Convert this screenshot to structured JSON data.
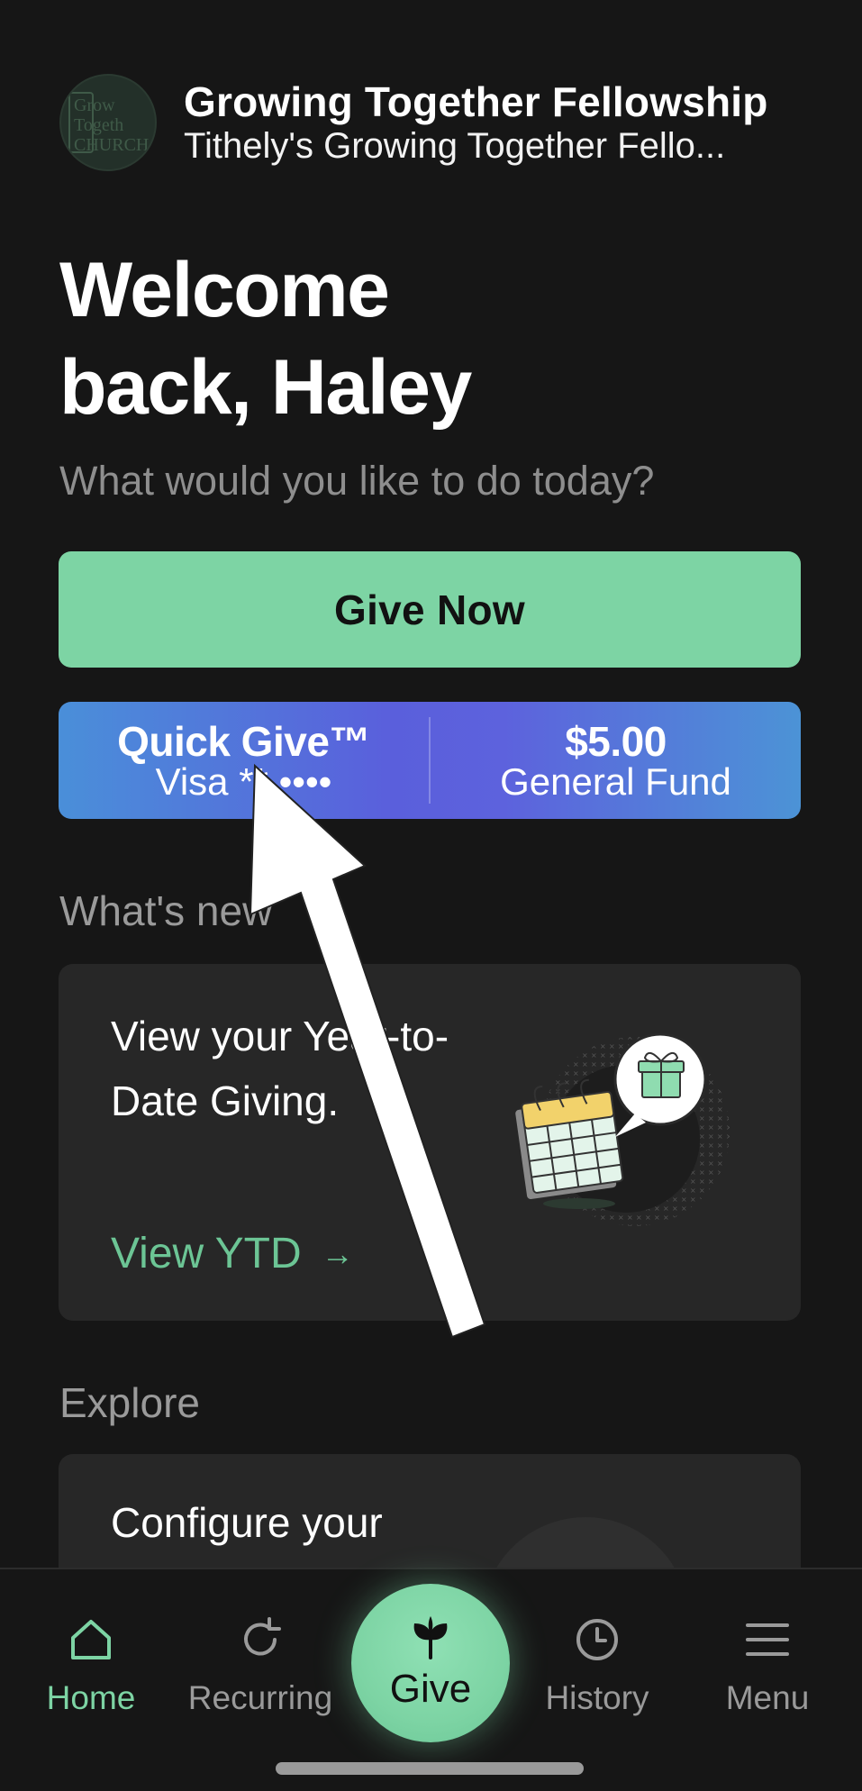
{
  "header": {
    "church_name": "Growing Together Fellowship",
    "church_subtitle": "Tithely's Growing Together Fello...",
    "logo_text": "Grow\nTogeth\nCHURCH"
  },
  "welcome": {
    "title_line1": "Welcome",
    "title_line2": "back, Haley",
    "subtitle": "What would you like to do today?"
  },
  "give_now": {
    "label": "Give Now"
  },
  "quick_give": {
    "title": "Quick Give™",
    "card": "Visa ** ••••",
    "amount": "$5.00",
    "fund": "General Fund"
  },
  "whats_new": {
    "heading": "What's new",
    "card_text": "View your Year-to-Date Giving.",
    "link_label": "View YTD",
    "link_arrow": "→"
  },
  "explore": {
    "heading": "Explore",
    "card_text": "Configure your"
  },
  "tab_bar": {
    "tabs": [
      {
        "label": "Home",
        "icon": "home-icon",
        "active": true
      },
      {
        "label": "Recurring",
        "icon": "recurring-icon",
        "active": false
      },
      {
        "label": "Give",
        "icon": "sprout-icon",
        "active": false
      },
      {
        "label": "History",
        "icon": "history-icon",
        "active": false
      },
      {
        "label": "Menu",
        "icon": "menu-icon",
        "active": false
      }
    ]
  },
  "colors": {
    "background": "#161616",
    "accent_green": "#7dd4a4",
    "card": "#272727",
    "muted_text": "#9a9a9a",
    "quick_give_blue": "#5a5fdc"
  }
}
